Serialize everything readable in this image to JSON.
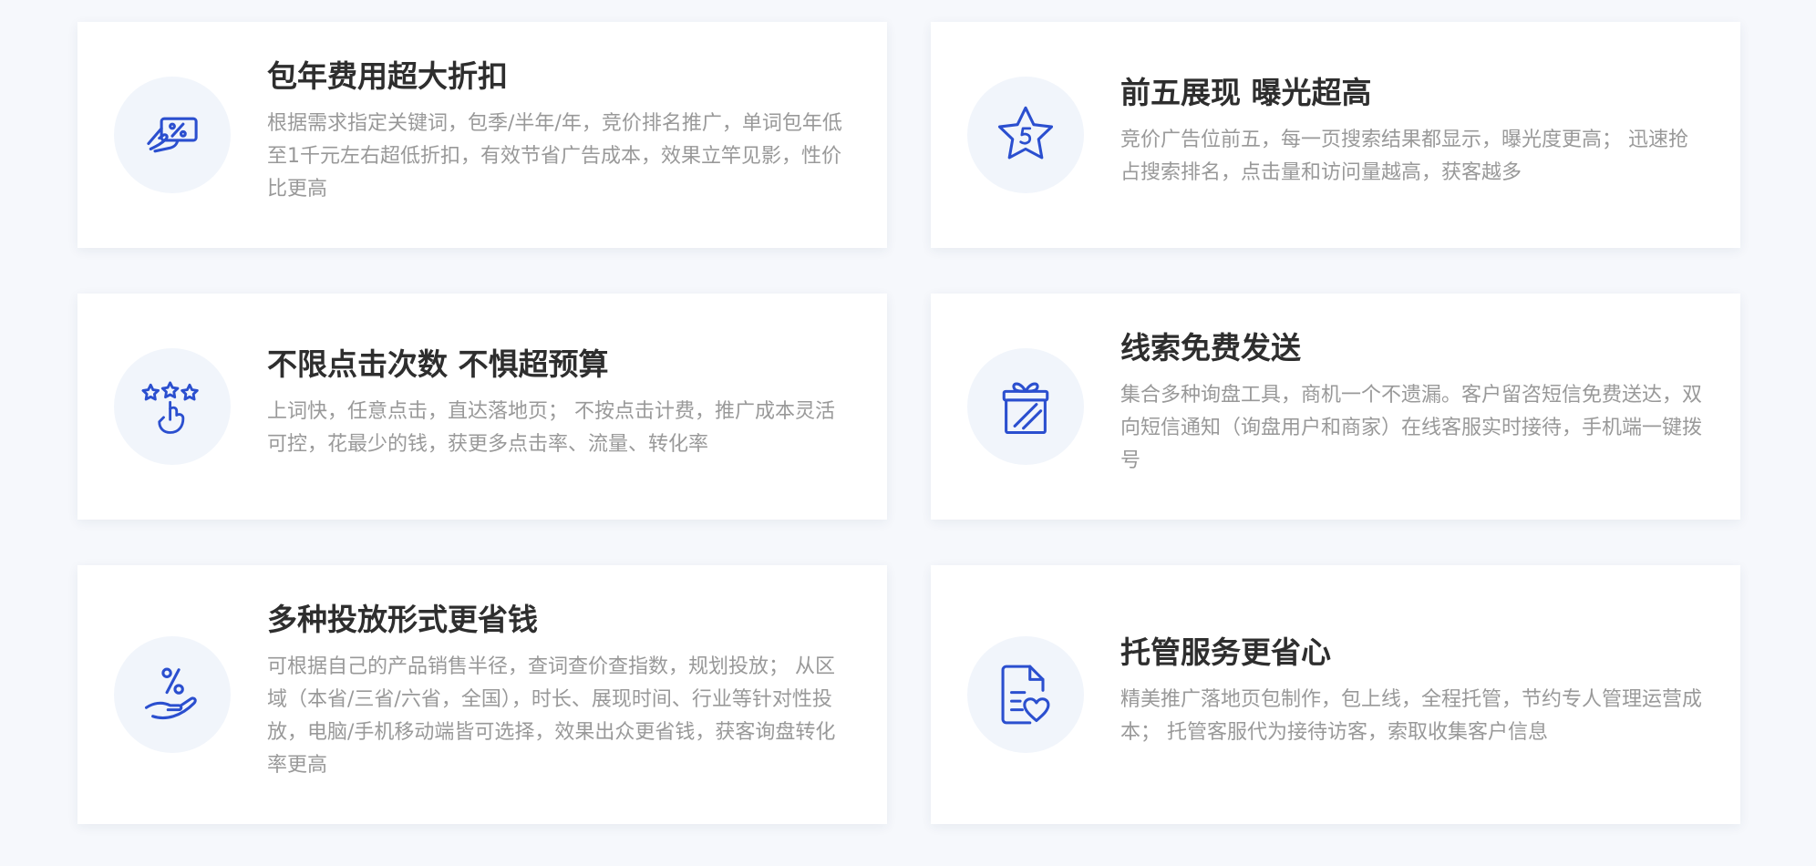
{
  "cards": [
    {
      "title": "包年费用超大折扣",
      "desc": "根据需求指定关键词，包季/半年/年，竞价排名推广，单词包年低至1千元左右超低折扣，有效节省广告成本，效果立竿见影，性价比更高",
      "icon": "discount-card-icon"
    },
    {
      "title": "前五展现 曝光超高",
      "desc": "竞价广告位前五，每一页搜索结果都显示，曝光度更高； 迅速抢占搜索排名，点击量和访问量越高，获客越多",
      "icon": "star-five-icon"
    },
    {
      "title": "不限点击次数 不惧超预算",
      "desc": "上词快，任意点击，直达落地页； 不按点击计费，推广成本灵活可控，花最少的钱，获更多点击率、流量、转化率",
      "icon": "stars-click-icon"
    },
    {
      "title": "线索免费发送",
      "desc": "集合多种询盘工具，商机一个不遗漏。客户留咨短信免费送达，双向短信通知（询盘用户和商家）在线客服实时接待，手机端一键拨号",
      "icon": "gift-icon"
    },
    {
      "title": "多种投放形式更省钱",
      "desc": "可根据自己的产品销售半径，查词查价查指数，规划投放； 从区域（本省/三省/六省，全国），时长、展现时间、行业等针对性投放，电脑/手机移动端皆可选择，效果出众更省钱，获客询盘转化率更高",
      "icon": "percent-hand-icon"
    },
    {
      "title": "托管服务更省心",
      "desc": "精美推广落地页包制作，包上线，全程托管，节约专人管理运营成本； 托管客服代为接待访客，索取收集客户信息",
      "icon": "document-heart-icon"
    }
  ],
  "colors": {
    "accent": "#2b4fcf",
    "icon_bg": "#f1f5fb",
    "title": "#2e2e2e",
    "desc": "#999999",
    "page_bg": "#f6f8fc"
  }
}
